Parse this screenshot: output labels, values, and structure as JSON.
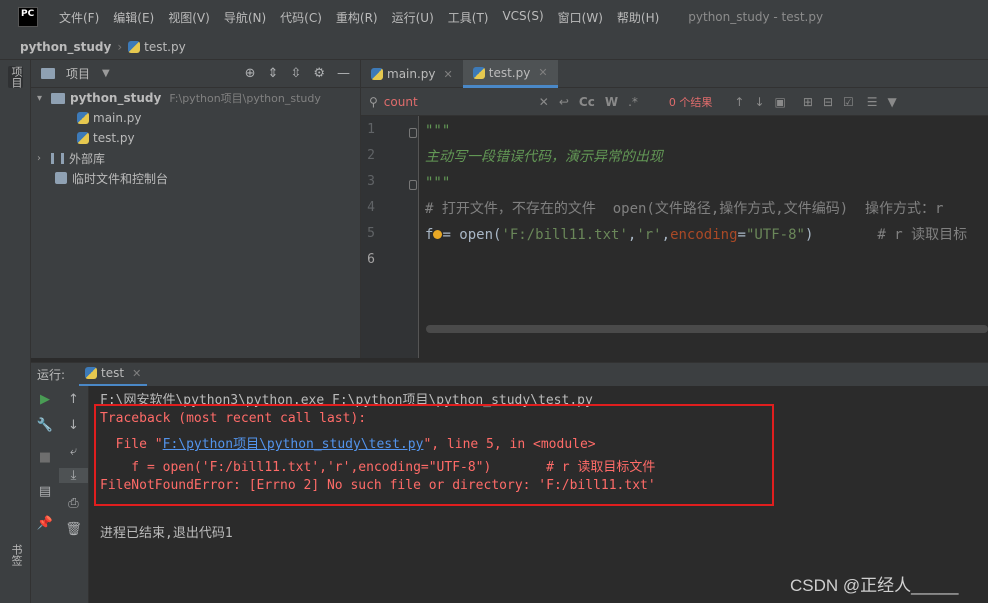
{
  "window": {
    "app_icon_label": "PC",
    "title": "python_study - test.py"
  },
  "menu": [
    "文件(F)",
    "编辑(E)",
    "视图(V)",
    "导航(N)",
    "代码(C)",
    "重构(R)",
    "运行(U)",
    "工具(T)",
    "VCS(S)",
    "窗口(W)",
    "帮助(H)"
  ],
  "navbar": {
    "project": "python_study",
    "file": "test.py"
  },
  "left_stripe": {
    "project_label": "项目",
    "bookmarks_label": "书签"
  },
  "project_panel": {
    "title": "项目",
    "root": {
      "name": "python_study",
      "path": "F:\\python项目\\python_study"
    },
    "files": [
      "main.py",
      "test.py"
    ],
    "external_libs": "外部库",
    "scratches": "临时文件和控制台"
  },
  "editor": {
    "tabs": [
      {
        "label": "main.py",
        "active": false
      },
      {
        "label": "test.py",
        "active": true
      }
    ],
    "search": {
      "value": "count",
      "results": "0 个结果"
    },
    "line_numbers": [
      "1",
      "2",
      "3",
      "4",
      "5",
      "6"
    ],
    "lines": {
      "l1": "\"\"\"",
      "l2": "主动写一段错误代码，演示异常的出现",
      "l3": "\"\"\"",
      "l4": "# 打开文件，不存在的文件  open(文件路径,操作方式,文件编码)  操作方式：r",
      "l5_var": "f",
      "l5_eq": "= ",
      "l5_fn": "open(",
      "l5_arg1": "'F:/bill11.txt'",
      "l5_comma1": ",",
      "l5_arg2": "'r'",
      "l5_comma2": ",",
      "l5_kw": "encoding",
      "l5_eq2": "=",
      "l5_arg3": "\"UTF-8\"",
      "l5_close": ")",
      "l5_comment": "# r 读取目标"
    }
  },
  "run_panel": {
    "label": "运行:",
    "tab": "test",
    "output": {
      "cmd": "F:\\网安软件\\python3\\python.exe F:\\python项目\\python_study\\test.py",
      "tb1": "Traceback (most recent call last):",
      "tb2_pre": "  File \"",
      "tb2_link": "F:\\python项目\\python_study\\test.py",
      "tb2_post": "\", line 5, in <module>",
      "tb3": "    f = open('F:/bill11.txt','r',encoding=\"UTF-8\")       # r 读取目标文件",
      "tb4": "FileNotFoundError: [Errno 2] No such file or directory: 'F:/bill11.txt'",
      "exit": "进程已结束,退出代码1"
    }
  },
  "watermark": "CSDN @正经人_____",
  "colors": {
    "error_red": "#ff6b68",
    "highlight_box": "#e01e1e",
    "accent_blue": "#4a88c7"
  }
}
